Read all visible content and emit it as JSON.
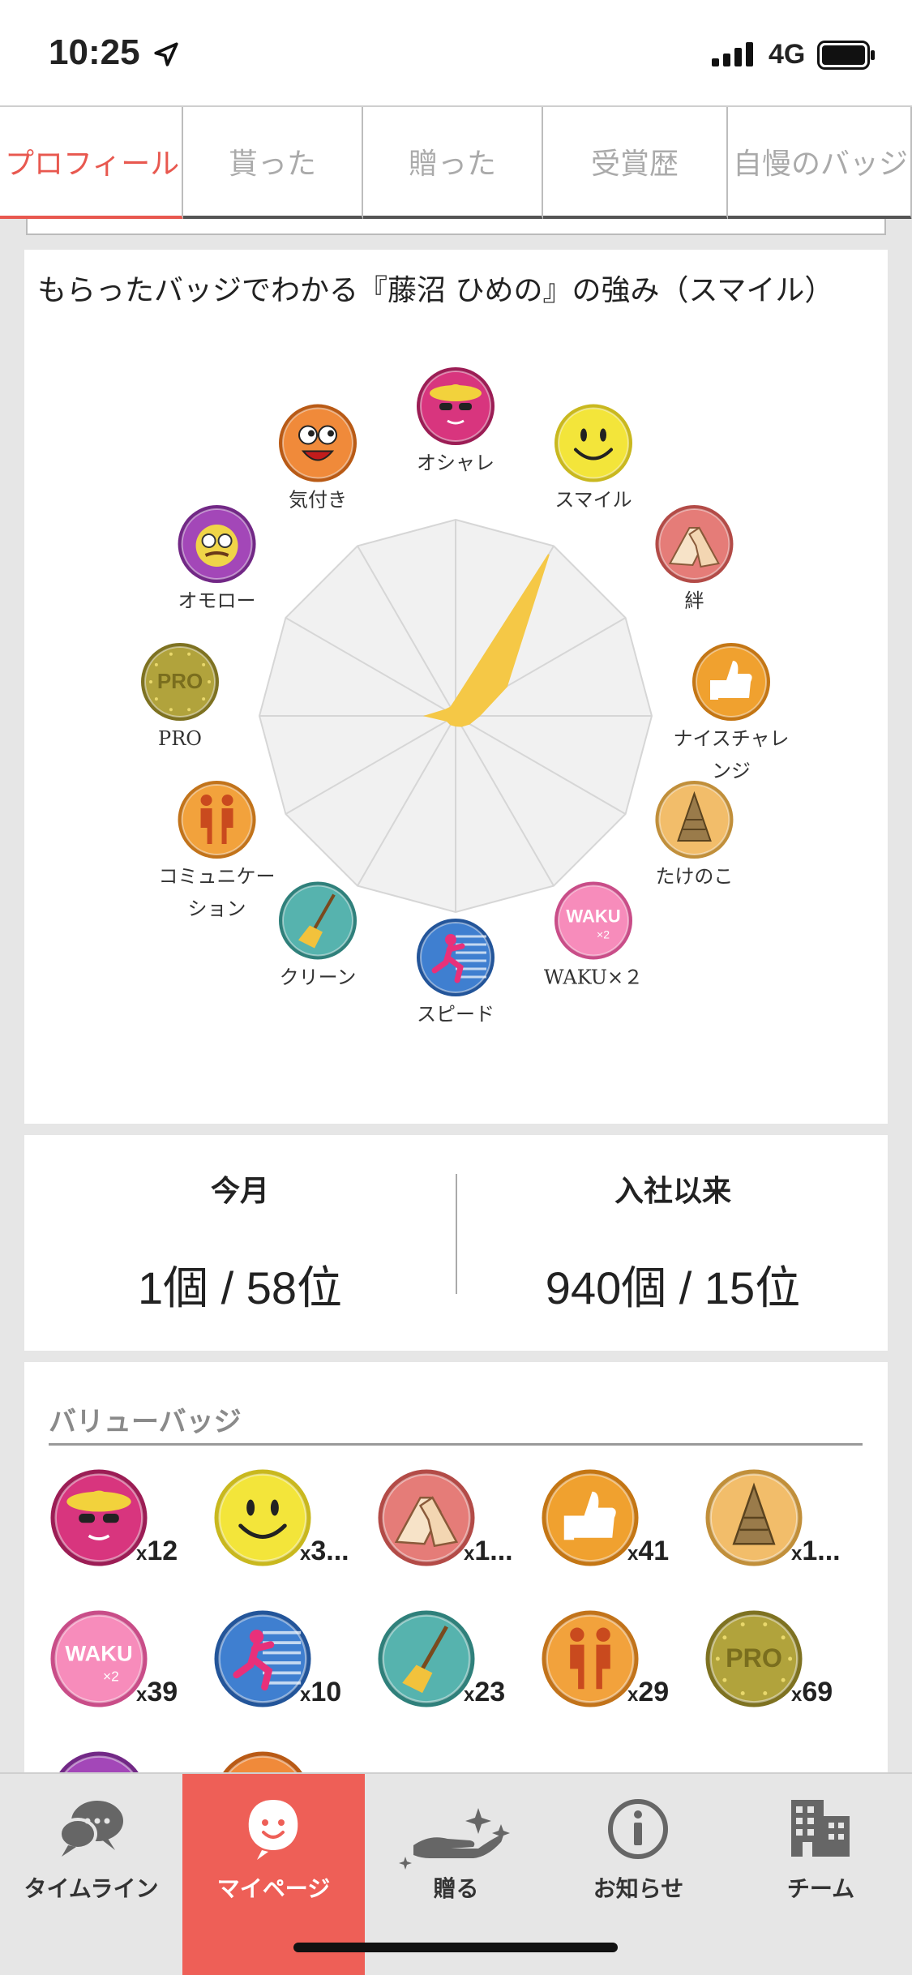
{
  "status_bar": {
    "time": "10:25",
    "network": "4G",
    "icons": [
      "location-arrow-icon",
      "signal-icon",
      "battery-icon"
    ]
  },
  "tabs": [
    {
      "label": "プロフィール",
      "active": true
    },
    {
      "label": "貰った",
      "active": false
    },
    {
      "label": "贈った",
      "active": false
    },
    {
      "label": "受賞歴",
      "active": false
    },
    {
      "label": "自慢のバッジ",
      "active": false
    }
  ],
  "radar": {
    "title": "もらったバッジでわかる『藤沼 ひめの』の強み（スマイル）",
    "fill_color": "#f5c846",
    "badges": [
      {
        "label": "オシャレ",
        "icon": "fashion-icon",
        "value": 0.08
      },
      {
        "label": "スマイル",
        "icon": "smile-icon",
        "value": 0.95
      },
      {
        "label": "絆",
        "icon": "handshake-icon",
        "value": 0.3
      },
      {
        "label": "ナイスチャレンジ",
        "icon": "thumbs-up-icon",
        "value": 0.12
      },
      {
        "label": "たけのこ",
        "icon": "bamboo-shoot-icon",
        "value": 0.08
      },
      {
        "label": "WAKU×２",
        "icon": "waku-icon",
        "value": 0.06
      },
      {
        "label": "スピード",
        "icon": "speed-icon",
        "value": 0.05
      },
      {
        "label": "クリーン",
        "icon": "broom-icon",
        "value": 0.05
      },
      {
        "label": "コミュニケーション",
        "icon": "communication-icon",
        "value": 0.05
      },
      {
        "label": "PRO",
        "icon": "pro-icon",
        "value": 0.15
      },
      {
        "label": "オモロー",
        "icon": "funny-glasses-icon",
        "value": 0.06
      },
      {
        "label": "気付き",
        "icon": "surprised-face-icon",
        "value": 0.05
      }
    ]
  },
  "stats": {
    "this_month": {
      "label": "今月",
      "value": "1個 / 58位"
    },
    "since_joined": {
      "label": "入社以来",
      "value": "940個 / 15位"
    }
  },
  "value_badges": {
    "heading": "バリューバッジ",
    "items": [
      {
        "icon": "fashion-icon",
        "count": "12"
      },
      {
        "icon": "smile-icon",
        "count": "3..."
      },
      {
        "icon": "handshake-icon",
        "count": "1..."
      },
      {
        "icon": "thumbs-up-icon",
        "count": "41"
      },
      {
        "icon": "bamboo-shoot-icon",
        "count": "1..."
      },
      {
        "icon": "waku-icon",
        "count": "39"
      },
      {
        "icon": "speed-icon",
        "count": "10"
      },
      {
        "icon": "broom-icon",
        "count": "23"
      },
      {
        "icon": "communication-icon",
        "count": "29"
      },
      {
        "icon": "pro-icon",
        "count": "69"
      },
      {
        "icon": "funny-glasses-icon",
        "count": ""
      },
      {
        "icon": "surprised-face-icon",
        "count": ""
      }
    ]
  },
  "bottom_nav": [
    {
      "label": "タイムライン",
      "icon": "chat-bubbles-icon",
      "active": false
    },
    {
      "label": "マイページ",
      "icon": "mypage-face-icon",
      "active": true
    },
    {
      "label": "贈る",
      "icon": "give-hand-icon",
      "active": false
    },
    {
      "label": "お知らせ",
      "icon": "info-icon",
      "active": false
    },
    {
      "label": "チーム",
      "icon": "building-icon",
      "active": false
    }
  ],
  "colors": {
    "accent": "#e8584f",
    "nav_active": "#ee5f57",
    "radar_fill": "#f5c846"
  }
}
